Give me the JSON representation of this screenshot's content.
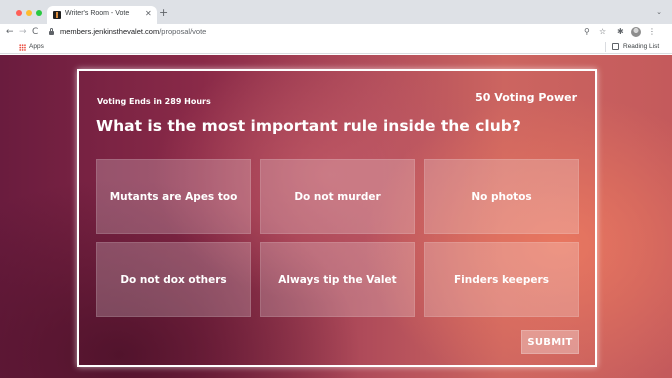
{
  "browser": {
    "tab_title": "Writer's Room - Vote",
    "tab_close": "✕",
    "new_tab": "+",
    "tab_dropdown": "⌄",
    "nav": {
      "back": "←",
      "forward": "→",
      "reload": "C"
    },
    "url_host": "members.jenkinsthevalet.com",
    "url_path": "/proposal/vote",
    "toolbar_icons": {
      "zoom": "⚲",
      "star": "☆",
      "extensions": "✱",
      "menu": "⋮"
    },
    "bookmarks": {
      "apps_label": "Apps",
      "reading_list_label": "Reading List"
    },
    "colors": {
      "tabbar": "#dee1e6",
      "close": "#ff5f57",
      "minimize": "#febc2e",
      "maximize": "#28c840"
    }
  },
  "vote": {
    "deadline": "Voting Ends in 289 Hours",
    "power": "50 Voting Power",
    "question": "What is the most important rule inside the club?",
    "options": [
      {
        "label": "Mutants are Apes too"
      },
      {
        "label": "Do not murder"
      },
      {
        "label": "No photos"
      },
      {
        "label": "Do not dox others"
      },
      {
        "label": "Always tip the Valet"
      },
      {
        "label": "Finders keepers"
      }
    ],
    "submit_label": "SUBMIT"
  },
  "theme": {
    "panel_border": "#ffffff",
    "bg_dark": "#6a1c3e",
    "bg_warm": "#e8785f"
  }
}
